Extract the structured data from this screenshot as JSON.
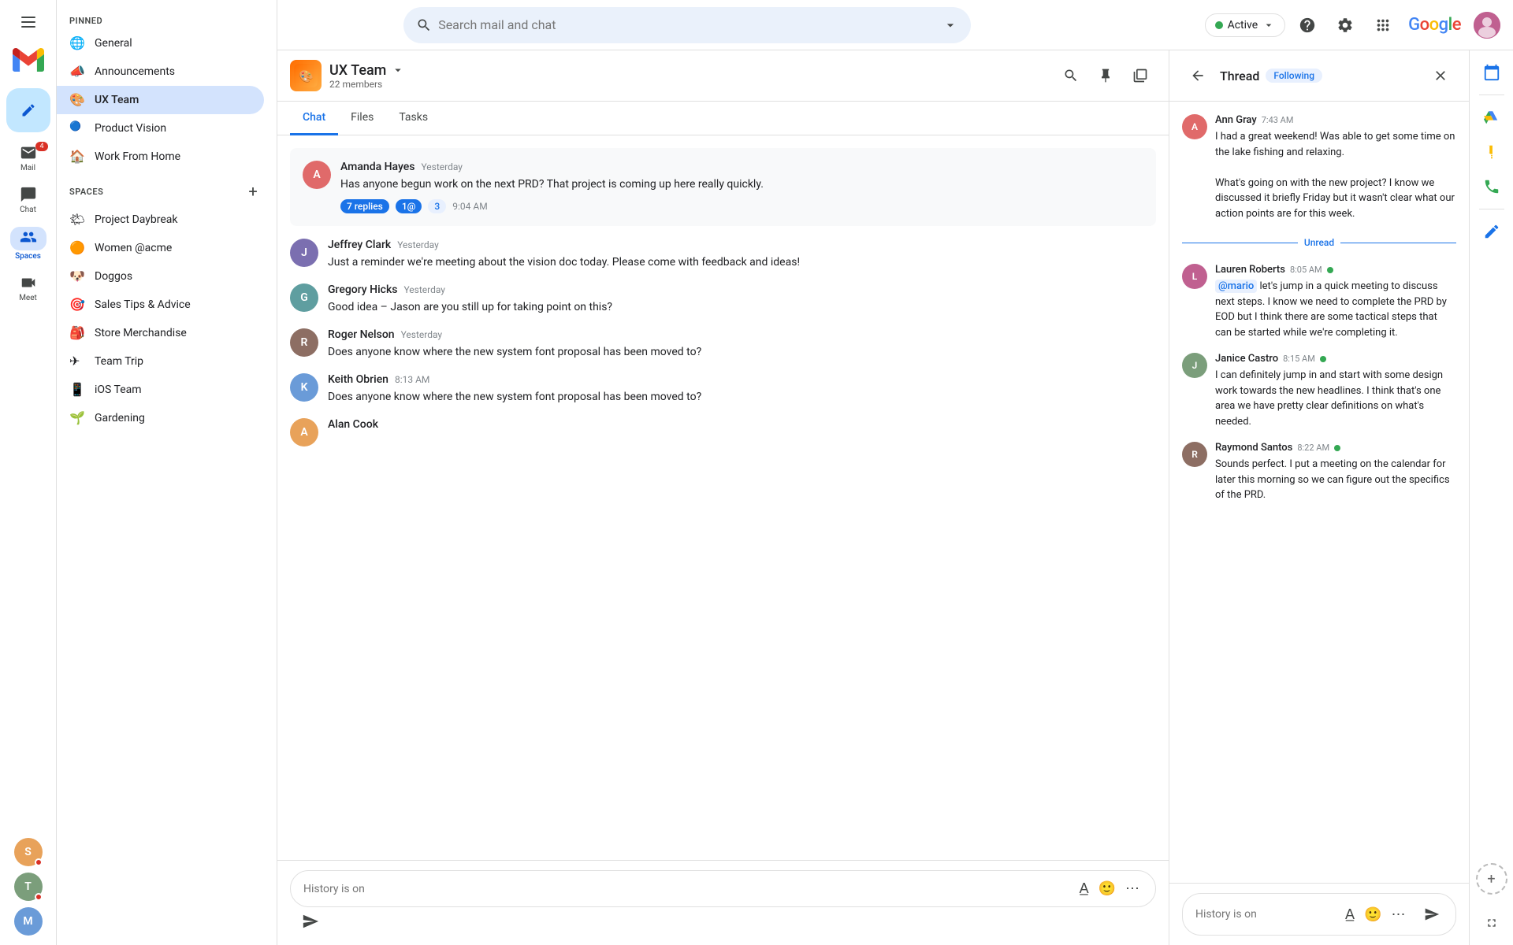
{
  "app": {
    "title": "Gmail",
    "logo_letter": "M"
  },
  "topbar": {
    "search_placeholder": "Search mail and chat",
    "active_label": "Active",
    "active_dropdown": "▾",
    "help_label": "Help",
    "settings_label": "Settings",
    "apps_label": "Google Apps",
    "google_label": "Google"
  },
  "sidebar": {
    "pinned_label": "PINNED",
    "spaces_label": "SPACES",
    "pinned_items": [
      {
        "id": "general",
        "label": "General",
        "icon": "🌐"
      },
      {
        "id": "announcements",
        "label": "Announcements",
        "icon": "📣"
      },
      {
        "id": "ux-team",
        "label": "UX Team",
        "icon": "🎨",
        "active": true
      },
      {
        "id": "product-vision",
        "label": "Product Vision",
        "icon": "🔵"
      },
      {
        "id": "work-from-home",
        "label": "Work From Home",
        "icon": "🏠"
      }
    ],
    "spaces_items": [
      {
        "id": "project-daybreak",
        "label": "Project Daybreak",
        "icon": "🌤"
      },
      {
        "id": "women-acme",
        "label": "Women @acme",
        "icon": "🟠"
      },
      {
        "id": "doggos",
        "label": "Doggos",
        "icon": "🐶"
      },
      {
        "id": "sales-tips",
        "label": "Sales Tips & Advice",
        "icon": "🎯"
      },
      {
        "id": "store-merch",
        "label": "Store Merchandise",
        "icon": "🎒"
      },
      {
        "id": "team-trip",
        "label": "Team Trip",
        "icon": "✈"
      },
      {
        "id": "ios-team",
        "label": "iOS Team",
        "icon": "📱"
      },
      {
        "id": "gardening",
        "label": "Gardening",
        "icon": "🌱"
      }
    ]
  },
  "nav_items": [
    {
      "id": "mail",
      "label": "Mail",
      "icon": "✉",
      "badge": "4"
    },
    {
      "id": "chat",
      "label": "Chat",
      "icon": "💬",
      "badge": null
    },
    {
      "id": "spaces",
      "label": "Spaces",
      "icon": "👥",
      "active": true
    },
    {
      "id": "meet",
      "label": "Meet",
      "icon": "📹",
      "badge": null
    }
  ],
  "chat_panel": {
    "group_name": "UX Team",
    "members_count": "22 members",
    "tabs": [
      {
        "id": "chat",
        "label": "Chat",
        "active": true
      },
      {
        "id": "files",
        "label": "Files"
      },
      {
        "id": "tasks",
        "label": "Tasks"
      }
    ],
    "messages": [
      {
        "id": "msg1",
        "sender": "Amanda Hayes",
        "time": "Yesterday",
        "text": "Has anyone begun work on the next PRD? That project is coming up here really quickly.",
        "replies_label": "7 replies",
        "mention_badge": "1@",
        "extra_badge": "3",
        "reply_time": "9:04 AM",
        "avatar_bg": "#e06a6a",
        "avatar_letter": "A"
      },
      {
        "id": "msg2",
        "sender": "Jeffrey Clark",
        "time": "Yesterday",
        "text": "Just a reminder we're meeting about the vision doc today. Please come with feedback and ideas!",
        "avatar_bg": "#7b6fb0",
        "avatar_letter": "J"
      },
      {
        "id": "msg3",
        "sender": "Gregory Hicks",
        "time": "Yesterday",
        "text": "Good idea – Jason are you still up for taking point on this?",
        "avatar_bg": "#5f9ea0",
        "avatar_letter": "G"
      },
      {
        "id": "msg4",
        "sender": "Roger Nelson",
        "time": "Yesterday",
        "text": "Does anyone know where the new system font proposal has been moved to?",
        "avatar_bg": "#8d6e63",
        "avatar_letter": "R"
      },
      {
        "id": "msg5",
        "sender": "Keith Obrien",
        "time": "8:13 AM",
        "text": "Does anyone know where the new system font proposal has been moved to?",
        "avatar_bg": "#6a9bd8",
        "avatar_letter": "K"
      },
      {
        "id": "msg6",
        "sender": "Alan Cook",
        "time": "",
        "text": "",
        "avatar_bg": "#e8a25a",
        "avatar_letter": "A"
      }
    ],
    "input_placeholder": "History is on",
    "send_label": "Send"
  },
  "thread_panel": {
    "title": "Thread",
    "following_label": "Following",
    "messages": [
      {
        "id": "tmsg1",
        "sender": "Ann Gray",
        "time": "7:43 AM",
        "text": "I had a great weekend! Was able to get some time on the lake fishing and relaxing.\n\nWhat's going on with the new project? I know we discussed it briefly Friday but it wasn't clear what our action points are for this week.",
        "avatar_bg": "#e06a6a",
        "avatar_letter": "A",
        "online": false
      },
      {
        "id": "tmsg2",
        "sender": "Lauren Roberts",
        "time": "8:05 AM",
        "text": "@mario let's jump in a quick meeting to discuss next steps. I know we need to complete the PRD by EOD but I think there are some tactical steps that can be started while we're completing it.",
        "avatar_bg": "#c06090",
        "avatar_letter": "L",
        "online": true,
        "mention": "@mario"
      },
      {
        "id": "tmsg3",
        "sender": "Janice Castro",
        "time": "8:15 AM",
        "text": "I can definitely jump in and start with some design work towards the new headlines. I think that's one area we have pretty clear definitions on what's needed.",
        "avatar_bg": "#7b9e7b",
        "avatar_letter": "J",
        "online": true
      },
      {
        "id": "tmsg4",
        "sender": "Raymond Santos",
        "time": "8:22 AM",
        "text": "Sounds perfect. I put a meeting on the calendar for later this morning so we can figure out the specifics of the PRD.",
        "avatar_bg": "#8d6e63",
        "avatar_letter": "R",
        "online": true
      }
    ],
    "unread_label": "Unread",
    "input_placeholder": "History is on"
  },
  "right_rail": {
    "icons": [
      {
        "id": "calendar",
        "icon": "📅",
        "label": "Calendar"
      },
      {
        "id": "drive",
        "icon": "△",
        "label": "Drive"
      },
      {
        "id": "keep",
        "icon": "💛",
        "label": "Keep"
      },
      {
        "id": "phone",
        "icon": "📞",
        "label": "Phone"
      },
      {
        "id": "tasks2",
        "icon": "✓",
        "label": "Tasks"
      },
      {
        "id": "add",
        "icon": "+",
        "label": "Add"
      }
    ]
  },
  "bottom_avatars": [
    {
      "id": "avatar1",
      "letter": "S",
      "bg": "#e8a25a",
      "badge_color": "#d93025"
    },
    {
      "id": "avatar2",
      "letter": "T",
      "bg": "#7b9e7b",
      "badge_color": "#d93025"
    },
    {
      "id": "avatar3",
      "letter": "M",
      "bg": "#6a9bd8",
      "badge_color": null
    }
  ],
  "colors": {
    "accent_blue": "#1a73e8",
    "green": "#34a853",
    "red": "#d93025"
  }
}
